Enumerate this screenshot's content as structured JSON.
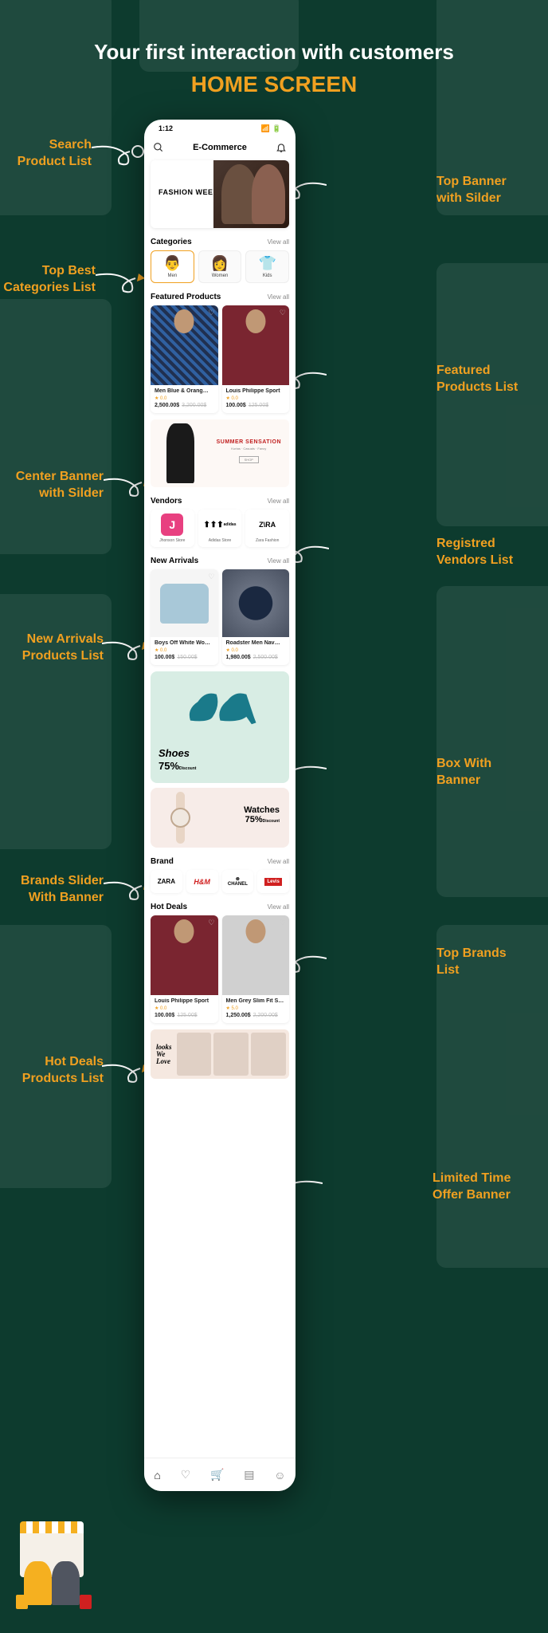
{
  "page": {
    "title": "Your first interaction with customers",
    "subtitle": "HOME SCREEN"
  },
  "annotations": {
    "search": "Search\nProduct List",
    "top_banner": "Top Banner\nwith Silder",
    "categories": "Top Best\nCategories List",
    "featured": "Featured\nProducts List",
    "center_banner": "Center Banner\nwith Silder",
    "vendors": "Registred\nVendors List",
    "new_arrivals": "New Arrivals\nProducts List",
    "box_banner": "Box With\nBanner",
    "brands_banner": "Brands Slider\nWith Banner",
    "top_brands": "Top Brands\nList",
    "hot_deals": "Hot Deals\nProducts List",
    "limited": "Limited Time\nOffer Banner"
  },
  "status": {
    "time": "1:12"
  },
  "header": {
    "title": "E-Commerce"
  },
  "top_banner": {
    "label": "FASHION WEEK"
  },
  "sections": {
    "categories": "Categories",
    "featured": "Featured Products",
    "vendors": "Vendors",
    "new_arrivals": "New Arrivals",
    "brand": "Brand",
    "hot_deals": "Hot Deals",
    "view_all": "View all"
  },
  "categories": [
    {
      "icon": "👨",
      "label": "Men"
    },
    {
      "icon": "👩",
      "label": "Women"
    },
    {
      "icon": "👕",
      "label": "Kids"
    }
  ],
  "featured": [
    {
      "name": "Men Blue & Orang…",
      "rating": "0.0",
      "price": "2,500.00$",
      "old_price": "3,200.00$"
    },
    {
      "name": "Louis Philippe Sport",
      "rating": "0.0",
      "price": "100.00$",
      "old_price": "125.00$"
    }
  ],
  "center_banner": {
    "title": "SUMMER SENSATION",
    "sub": "Kurtas · Casuals · Fancy",
    "shop": "SHOP"
  },
  "vendors": [
    {
      "logo": "J",
      "name": "Jhonson Store",
      "color": "#e84080"
    },
    {
      "logo": "⚘",
      "name": "Adidas Store",
      "color": "#000"
    },
    {
      "logo": "Z\\RA",
      "name": "Zara Fashion",
      "color": "#000"
    }
  ],
  "new_arrivals": [
    {
      "name": "Boys Off White Wo…",
      "rating": "0.0",
      "price": "100.00$",
      "old_price": "150.00$"
    },
    {
      "name": "Roadster Men Nav…",
      "rating": "0.0",
      "price": "1,980.00$",
      "old_price": "2,500.00$"
    }
  ],
  "shoes_banner": {
    "title": "Shoes",
    "discount": "75%",
    "sub": "Discount"
  },
  "watches_banner": {
    "title": "Watches",
    "discount": "75%",
    "sub": "Discount"
  },
  "brands": [
    "ZARA",
    "H&M",
    "CHANEL",
    "Levis"
  ],
  "hot_deals": [
    {
      "name": "Louis Philippe Sport",
      "rating": "0.0",
      "price": "100.00$",
      "old_price": "125.00$"
    },
    {
      "name": "Men Grey Slim Fit S…",
      "rating": "5.0",
      "price": "1,250.00$",
      "old_price": "2,200.00$"
    }
  ],
  "limited_banner": {
    "title": "looks\nWe\nLove"
  }
}
